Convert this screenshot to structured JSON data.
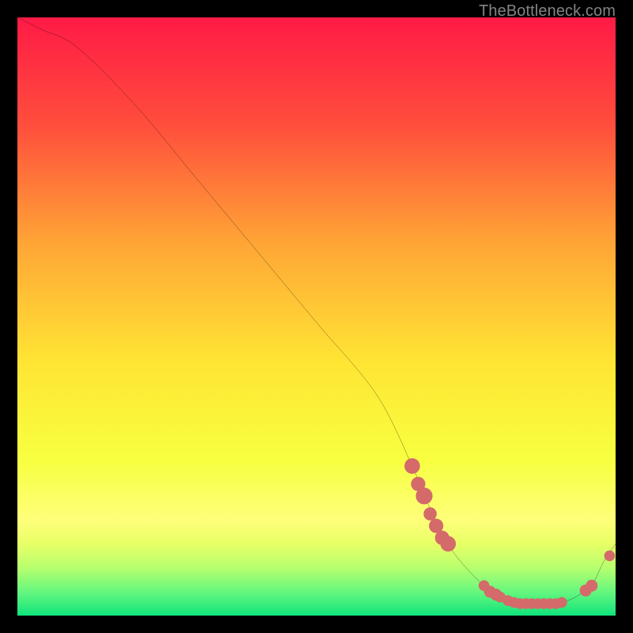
{
  "watermark": "TheBottleneck.com",
  "colors": {
    "gradient_stops": [
      "#ff1a46",
      "#ff5d3a",
      "#ffa636",
      "#ffe634",
      "#f7ff40",
      "#d4ff56",
      "#7cff7c",
      "#10e47c"
    ],
    "curve": "#000000",
    "marker": "#d46a6a"
  },
  "chart_data": {
    "type": "line",
    "title": "",
    "xlabel": "",
    "ylabel": "",
    "xlim": [
      0,
      100
    ],
    "ylim": [
      0,
      100
    ],
    "series": [
      {
        "name": "bottleneck-curve",
        "x": [
          0,
          4,
          10,
          20,
          30,
          40,
          50,
          60,
          66,
          68,
          72,
          75,
          78,
          80,
          82,
          84,
          86,
          88,
          90,
          92,
          94,
          96,
          98,
          100
        ],
        "y": [
          100,
          98,
          95,
          85,
          73,
          61,
          49,
          37,
          25,
          20,
          12,
          8,
          5,
          3.5,
          2.5,
          2,
          2,
          2,
          2,
          2.5,
          3.5,
          5,
          9,
          12
        ]
      }
    ],
    "markers": [
      {
        "x": 66,
        "y": 25,
        "r": 1.3
      },
      {
        "x": 67,
        "y": 22,
        "r": 1.2
      },
      {
        "x": 68,
        "y": 20,
        "r": 1.4
      },
      {
        "x": 69,
        "y": 17,
        "r": 1.1
      },
      {
        "x": 70,
        "y": 15,
        "r": 1.2
      },
      {
        "x": 71,
        "y": 13,
        "r": 1.2
      },
      {
        "x": 72,
        "y": 12,
        "r": 1.3
      },
      {
        "x": 78,
        "y": 5,
        "r": 0.9
      },
      {
        "x": 79,
        "y": 4,
        "r": 1.0
      },
      {
        "x": 80,
        "y": 3.5,
        "r": 1.0
      },
      {
        "x": 80.7,
        "y": 3.1,
        "r": 0.9
      },
      {
        "x": 82,
        "y": 2.5,
        "r": 0.9
      },
      {
        "x": 83,
        "y": 2.2,
        "r": 0.9
      },
      {
        "x": 84,
        "y": 2,
        "r": 0.9
      },
      {
        "x": 85,
        "y": 2,
        "r": 0.9
      },
      {
        "x": 86,
        "y": 2,
        "r": 0.9
      },
      {
        "x": 87,
        "y": 2,
        "r": 0.9
      },
      {
        "x": 88,
        "y": 2,
        "r": 0.9
      },
      {
        "x": 89,
        "y": 2,
        "r": 0.9
      },
      {
        "x": 90,
        "y": 2,
        "r": 0.9
      },
      {
        "x": 91,
        "y": 2.2,
        "r": 0.9
      },
      {
        "x": 95,
        "y": 4.2,
        "r": 1.0
      },
      {
        "x": 96,
        "y": 5,
        "r": 1.0
      },
      {
        "x": 99,
        "y": 10,
        "r": 0.9
      }
    ]
  }
}
